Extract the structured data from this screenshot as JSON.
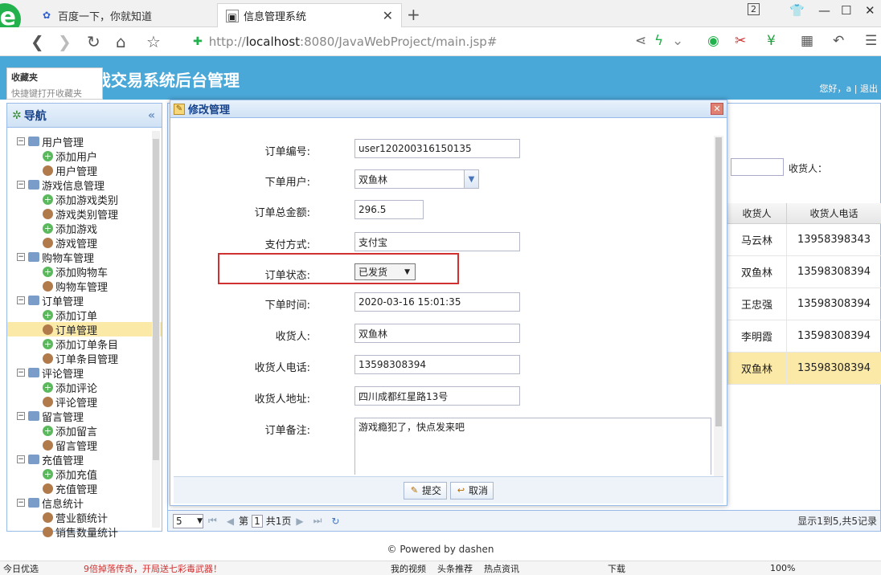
{
  "browser": {
    "tabs": [
      {
        "title": "百度一下，你就知道"
      },
      {
        "title": "信息管理系统"
      }
    ],
    "tab_count": "2",
    "url_prefix": "http://",
    "url_host": "localhost",
    "url_rest": ":8080/JavaWebProject/main.jsp#"
  },
  "favorites": {
    "title": "收藏夹",
    "hint": "快捷键打开收藏夹"
  },
  "app": {
    "title": "戏交易系统后台管理",
    "greeting": "您好，a | 退出"
  },
  "nav": {
    "title": "导航",
    "groups": [
      {
        "label": "用户管理",
        "items": [
          "添加用户",
          "用户管理"
        ]
      },
      {
        "label": "游戏信息管理",
        "items": [
          "添加游戏类别",
          "游戏类别管理",
          "添加游戏",
          "游戏管理"
        ]
      },
      {
        "label": "购物车管理",
        "items": [
          "添加购物车",
          "购物车管理"
        ]
      },
      {
        "label": "订单管理",
        "items": [
          "添加订单",
          "订单管理",
          "添加订单条目",
          "订单条目管理"
        ]
      },
      {
        "label": "评论管理",
        "items": [
          "添加评论",
          "评论管理"
        ]
      },
      {
        "label": "留言管理",
        "items": [
          "添加留言",
          "留言管理"
        ]
      },
      {
        "label": "充值管理",
        "items": [
          "添加充值",
          "充值管理"
        ]
      },
      {
        "label": "信息统计",
        "items": [
          "营业额统计",
          "销售数量统计"
        ]
      }
    ]
  },
  "grid": {
    "search_label": "收货人：",
    "columns": [
      "收货人",
      "收货人电话"
    ],
    "rows": [
      {
        "receiver": "马云林",
        "phone": "13958398343"
      },
      {
        "receiver": "双鱼林",
        "phone": "13598308394"
      },
      {
        "receiver": "王忠强",
        "phone": "13598308394"
      },
      {
        "receiver": "李明霞",
        "phone": "13598308394"
      },
      {
        "receiver": "双鱼林",
        "phone": "13598308394"
      }
    ],
    "pager": {
      "page_size": "5",
      "page_prefix": "第",
      "page_num": "1",
      "page_total": "共1页",
      "info": "显示1到5,共5记录"
    }
  },
  "modal": {
    "title": "修改管理",
    "fields": {
      "order_no": {
        "label": "订单编号:",
        "value": "user120200316150135"
      },
      "user": {
        "label": "下单用户:",
        "value": "双鱼林"
      },
      "total": {
        "label": "订单总金额:",
        "value": "296.5"
      },
      "pay": {
        "label": "支付方式:",
        "value": "支付宝"
      },
      "state": {
        "label": "订单状态:",
        "value": "已发货"
      },
      "time": {
        "label": "下单时间:",
        "value": "2020-03-16 15:01:35"
      },
      "receiver": {
        "label": "收货人:",
        "value": "双鱼林"
      },
      "phone": {
        "label": "收货人电话:",
        "value": "13598308394"
      },
      "address": {
        "label": "收货人地址:",
        "value": "四川成都红星路13号"
      },
      "memo": {
        "label": "订单备注:",
        "value": "游戏瘾犯了，快点发来吧"
      }
    },
    "submit_label": "提交",
    "cancel_label": "取消"
  },
  "footer": "© Powered by dashen",
  "statusbar": {
    "left": "今日优选",
    "news": "9倍掉落传奇，开局送七彩毒武器！",
    "video": "我的视频",
    "recommend": "头条推荐",
    "hot": "热点资讯",
    "download": "下载",
    "zoom": "100%"
  },
  "colors": {
    "header_blue": "#4aa8d8",
    "highlight_yellow": "#fbe9a8",
    "red_box": "#d03030"
  }
}
